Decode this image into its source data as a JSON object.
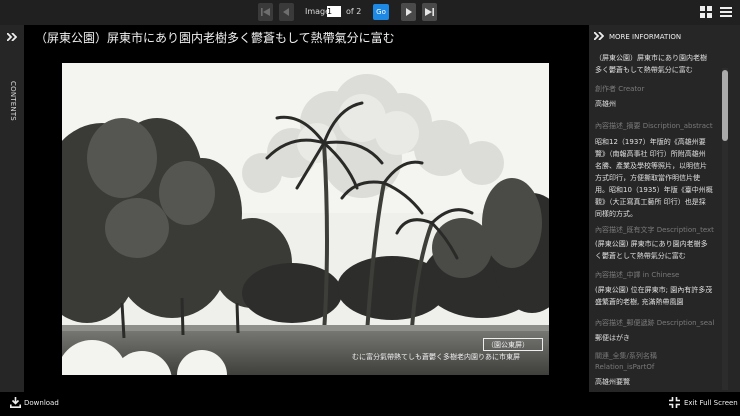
{
  "topbar": {
    "image_label": "Image",
    "page_value": "1",
    "of_label": "of 2",
    "go_label": "Go"
  },
  "contents_label": "CONTENTS",
  "title": "（屏東公園）屏東市にあり園内老樹多く鬱蒼もして熱帶氣分に富む",
  "photo": {
    "stamp_text": "（園公東屏）",
    "caption_text": "むに富分氣帶熱てしも蒼鬱く多樹老内園りあに市東屏"
  },
  "panel": {
    "title": "MORE INFORMATION",
    "entries": [
      {
        "label": "",
        "value_lines": [
          "（屏東公園）屏東市にあり園内老樹",
          "多く鬱蒼もして熱帶氣分に富む"
        ]
      },
      {
        "label": "創作者 Creator",
        "value_lines": [
          "高雄州"
        ]
      },
      {
        "label": "內容描述_摘要 Discription_abstract",
        "value_lines": [
          "昭和12（1937）年版的《高雄州要",
          "覽》（南報高事社 印行）所附高雄州",
          "名勝、產業及學校等照片，以明信片",
          "方式印行，方便撕取當作明信片使",
          "用。昭和10（1935）年版《臺中州概",
          "觀》（大正寫真工藝所 印行）也是採",
          "同樣的方式。"
        ]
      },
      {
        "label": "內容描述_既有文字 Description_text",
        "value_lines": [
          "(屏東公園) 屏東市にあり園内老樹多",
          "く鬱蒼として熱帶氣分に富む"
        ]
      },
      {
        "label": "內容描述_中譯 in Chinese",
        "value_lines": [
          "(屏東公園) 位在屏東市; 園內有許多茂",
          "盛繁蒼的老樹, 充滿熱帶風園"
        ]
      },
      {
        "label": "內容描述_郵便遞跡 Description_seal",
        "value_lines": [
          "郵便はがき"
        ]
      },
      {
        "label": "關連_全集/系列名稱",
        "value_lines": []
      },
      {
        "label": "Relation_isPartOf",
        "value_lines": []
      },
      {
        "label": "",
        "value_lines": [
          "高雄州要覽"
        ]
      }
    ]
  },
  "bottombar": {
    "download_label": "Download",
    "fullscreen_label": "Exit Full Screen"
  }
}
